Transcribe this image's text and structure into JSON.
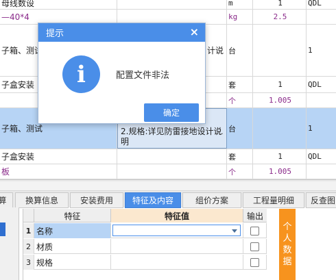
{
  "grid": {
    "rows": [
      {
        "c1": "母线数设",
        "c2": "",
        "c3": "m",
        "c4": "1",
        "c5": "QDL",
        "style": "plain"
      },
      {
        "c1": "—40*4",
        "c2": "",
        "c3": "kg",
        "c4": "2.5",
        "c5": "",
        "style": "purple"
      },
      {
        "c1": "子箱、测试",
        "c2": "计说",
        "c3": "台",
        "c4": "",
        "c5": "1",
        "style": "plain"
      },
      {
        "c1": "子盒安装",
        "c2": "",
        "c3": "套",
        "c4": "1",
        "c5": "QDL",
        "style": "plain"
      },
      {
        "c1": "",
        "c2": "",
        "c3": "个",
        "c4": "1.005",
        "c5": "",
        "style": "purple"
      },
      {
        "c1": "子箱、测试",
        "c2": "",
        "c3": "台",
        "c4": "",
        "c5": "1",
        "style": "selected"
      },
      {
        "c1": "子盒安装",
        "c2": "",
        "c3": "套",
        "c4": "1",
        "c5": "QDL",
        "style": "plain"
      },
      {
        "c1": "板",
        "c2": "",
        "c3": "个",
        "c4": "1.005",
        "c5": "",
        "style": "purple"
      }
    ],
    "edit_text": "2.规格:详见防雷接地设计说明",
    "edit_more": "…"
  },
  "tabs": [
    {
      "label": "算",
      "active": false
    },
    {
      "label": "换算信息",
      "active": false
    },
    {
      "label": "安装费用",
      "active": false
    },
    {
      "label": "特征及内容",
      "active": true
    },
    {
      "label": "组价方案",
      "active": false
    },
    {
      "label": "工程量明细",
      "active": false
    },
    {
      "label": "反查图",
      "active": false
    }
  ],
  "features": {
    "header": {
      "feature": "特征",
      "value": "特征值",
      "output": "输出"
    },
    "rows": [
      {
        "idx": "1",
        "name": "名称",
        "value": "",
        "checked": false
      },
      {
        "idx": "2",
        "name": "材质",
        "value": "",
        "checked": false
      },
      {
        "idx": "3",
        "name": "规格",
        "value": "",
        "checked": false
      }
    ]
  },
  "side_button": {
    "chars": [
      "个",
      "人",
      "数",
      "据"
    ]
  },
  "dialog": {
    "title": "提示",
    "close": "×",
    "icon": "i",
    "message": "配置文件非法",
    "ok": "确定"
  },
  "colors": {
    "accent": "#4a8ee8",
    "selection": "#b7d4f5",
    "orange": "#f7931e",
    "purple": "#8a2a8a"
  }
}
